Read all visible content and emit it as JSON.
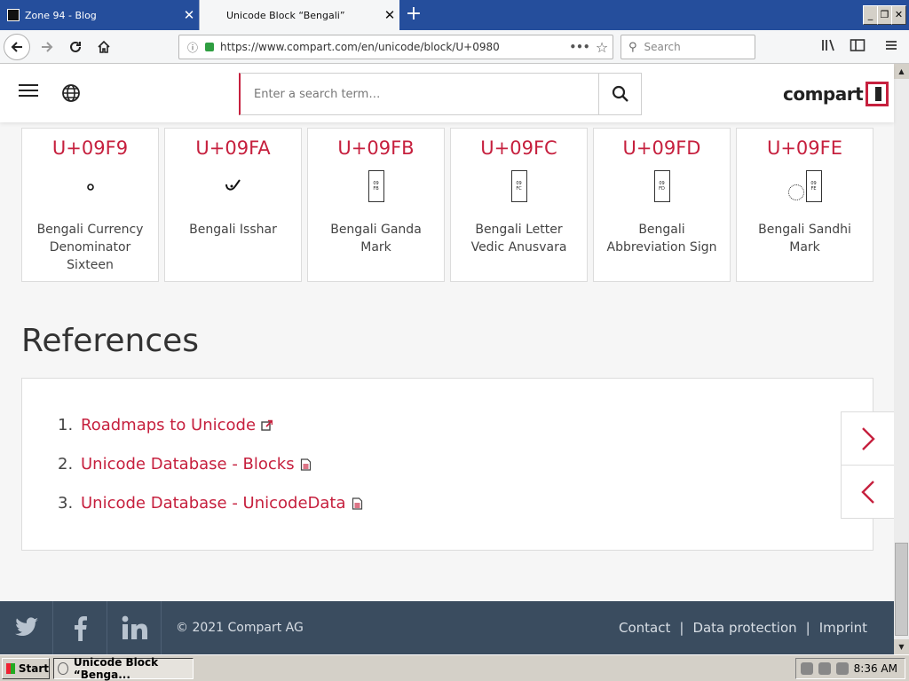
{
  "browser": {
    "tabs": [
      {
        "title": "Zone 94 - Blog",
        "active": false
      },
      {
        "title": "Unicode Block “Bengali”",
        "active": true
      }
    ],
    "url": "https://www.compart.com/en/unicode/block/U+0980",
    "search_placeholder": "Search",
    "icons": {
      "back": "back-arrow-icon",
      "forward": "forward-arrow-icon",
      "reload": "reload-icon",
      "home": "home-icon",
      "info": "info-icon",
      "lock": "lock-icon",
      "page_actions": "more-dots-icon",
      "bookmark": "star-icon",
      "library": "library-icon",
      "sidebar": "sidebar-icon",
      "menu": "hamburger-menu-icon"
    }
  },
  "site": {
    "search_placeholder": "Enter a search term…",
    "logo_text": "compart",
    "brand_color": "#c6203e"
  },
  "cards": [
    {
      "code": "U+09F9",
      "name": "Bengali Currency Denominator Sixteen",
      "glyph": "circle-glyph"
    },
    {
      "code": "U+09FA",
      "name": "Bengali Isshar",
      "glyph": "isshar-glyph"
    },
    {
      "code": "U+09FB",
      "name": "Bengali Ganda Mark",
      "glyph": "missing-glyph",
      "glyph_hex": [
        "09",
        "FB"
      ]
    },
    {
      "code": "U+09FC",
      "name": "Bengali Letter Vedic Anusvara",
      "glyph": "missing-glyph",
      "glyph_hex": [
        "09",
        "FC"
      ]
    },
    {
      "code": "U+09FD",
      "name": "Bengali Abbreviation Sign",
      "glyph": "missing-glyph",
      "glyph_hex": [
        "09",
        "FD"
      ]
    },
    {
      "code": "U+09FE",
      "name": "Bengali Sandhi Mark",
      "glyph": "dotted-circle-missing-glyph",
      "glyph_hex": [
        "09",
        "FE"
      ]
    }
  ],
  "references": {
    "title": "References",
    "items": [
      {
        "num": "1.",
        "label": "Roadmaps to Unicode",
        "icon": "external-link-icon"
      },
      {
        "num": "2.",
        "label": "Unicode Database - Blocks",
        "icon": "document-icon"
      },
      {
        "num": "3.",
        "label": "Unicode Database - UnicodeData",
        "icon": "document-icon"
      }
    ]
  },
  "footer": {
    "social": [
      "twitter-icon",
      "facebook-icon",
      "linkedin-icon"
    ],
    "copyright": "© 2021 Compart AG",
    "links": [
      "Contact",
      "Data protection",
      "Imprint"
    ],
    "separator": "|"
  },
  "taskbar": {
    "start_label": "Start",
    "task_label": "Unicode Block “Benga...",
    "clock": "8:36 AM"
  }
}
